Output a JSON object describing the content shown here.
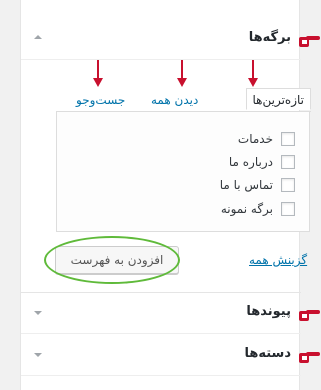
{
  "sections": {
    "pages": {
      "title": "برگه‌ها"
    },
    "links": {
      "title": "پیوندها"
    },
    "categories": {
      "title": "دسته‌ها"
    }
  },
  "tabs": {
    "recent": "تازه‌ترین‌ها",
    "view_all": "دیدن همه",
    "search": "جست‌وجو"
  },
  "items": [
    {
      "label": "خدمات",
      "checked": false
    },
    {
      "label": "درباره ما",
      "checked": false
    },
    {
      "label": "تماس با ما",
      "checked": false
    },
    {
      "label": "برگه نمونه",
      "checked": false
    }
  ],
  "select_all": "گزینش همه",
  "add_button": "افزودن به فهرست",
  "colors": {
    "annotation_red": "#c8102e",
    "highlight_green": "#5fba3a",
    "link_blue": "#0073aa"
  }
}
